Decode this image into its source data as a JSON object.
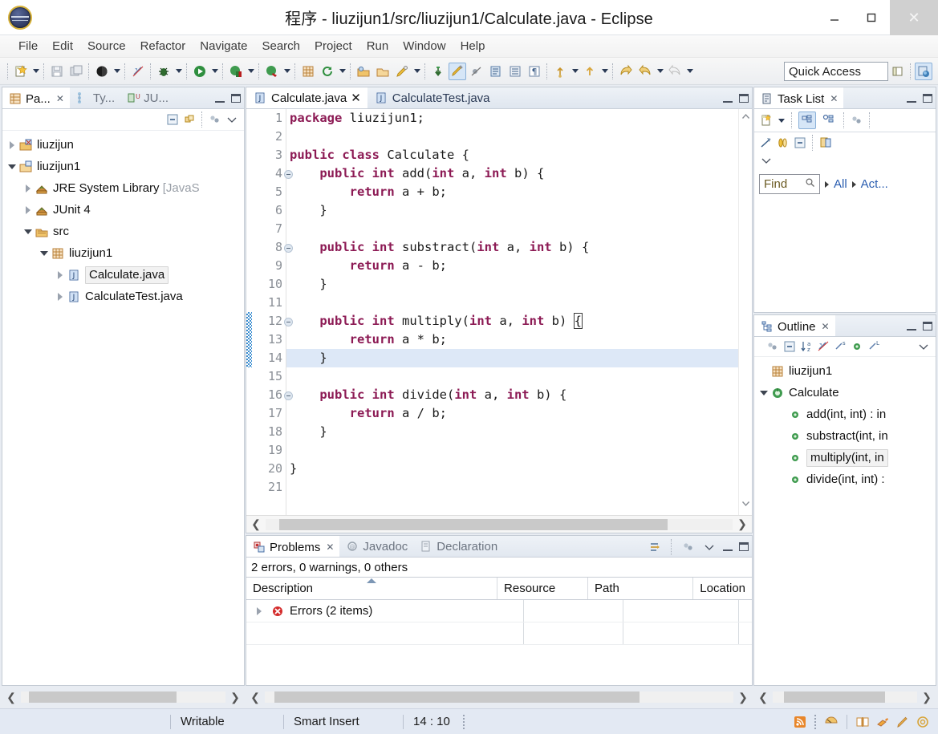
{
  "window": {
    "title": "程序 - liuzijun1/src/liuzijun1/Calculate.java - Eclipse",
    "minimize_label": "–",
    "maximize_label": "☐",
    "close_label": "✕"
  },
  "menubar": {
    "items": [
      "File",
      "Edit",
      "Source",
      "Refactor",
      "Navigate",
      "Search",
      "Project",
      "Run",
      "Window",
      "Help"
    ]
  },
  "toolbar": {
    "quick_access_placeholder": "Quick Access",
    "icons": [
      "new-wizard-icon",
      "new-wizard-dropdown",
      "save-icon",
      "save-all-icon",
      "print-icon",
      "print-dropdown",
      "toggle-breadcrumb-icon",
      "debug-icon",
      "debug-dropdown",
      "run-icon",
      "run-dropdown",
      "coverage-icon",
      "coverage-dropdown",
      "external-tools-icon",
      "external-tools-dropdown",
      "new-java-package-icon",
      "refresh-icon",
      "refresh-dropdown",
      "open-type-icon",
      "open-task-icon",
      "search-icon",
      "search-dropdown",
      "pin-editor-icon",
      "toggle-mark-occurrences-icon",
      "skip-breakpoints-icon",
      "next-annotation-icon",
      "previous-annotation-icon",
      "last-edit-location-icon",
      "last-edit-dropdown",
      "back-icon",
      "forward-icon",
      "forward-dropdown",
      "next-icon",
      "next-dropdown"
    ],
    "right_icons": [
      "new-perspective-icon",
      "java-perspective-icon"
    ]
  },
  "package_explorer": {
    "tabs": [
      {
        "label": "Pa...",
        "icon": "package-explorer-icon",
        "active": true,
        "closable": true
      },
      {
        "label": "Ty...",
        "icon": "type-hierarchy-icon",
        "active": false,
        "closable": false
      },
      {
        "label": "JU...",
        "icon": "junit-icon",
        "active": false,
        "closable": false
      }
    ],
    "toolbar_icons": [
      "collapse-all-icon",
      "link-with-editor-icon",
      "view-menu-icon",
      "view-chevron-icon"
    ],
    "controls": [
      "minimize-icon",
      "maximize-icon"
    ],
    "tree": [
      {
        "label": "liuzijun",
        "icon": "java-project-icon",
        "indent": 0,
        "twist": "closed",
        "selected": false
      },
      {
        "label": "liuzijun1",
        "icon": "java-project-open-icon",
        "indent": 0,
        "twist": "open",
        "selected": false
      },
      {
        "label": "JRE System Library",
        "suffix": " [JavaS",
        "icon": "library-icon",
        "indent": 1,
        "twist": "closed",
        "selected": false
      },
      {
        "label": "JUnit 4",
        "icon": "library-icon",
        "indent": 1,
        "twist": "closed",
        "selected": false
      },
      {
        "label": "src",
        "icon": "source-folder-icon",
        "indent": 1,
        "twist": "open",
        "selected": false
      },
      {
        "label": "liuzijun1",
        "icon": "package-icon",
        "indent": 2,
        "twist": "open",
        "selected": false
      },
      {
        "label": "Calculate.java",
        "icon": "java-file-icon",
        "indent": 3,
        "twist": "closed",
        "selected": true
      },
      {
        "label": "CalculateTest.java",
        "icon": "java-file-icon",
        "indent": 3,
        "twist": "closed",
        "selected": false
      }
    ],
    "hscroll": {
      "thumb_left_pct": 4,
      "thumb_width_pct": 72
    }
  },
  "editor": {
    "tabs": [
      {
        "label": "Calculate.java",
        "icon": "java-file-icon",
        "active": true,
        "closable": true
      },
      {
        "label": "CalculateTest.java",
        "icon": "java-file-icon",
        "active": false,
        "closable": false
      }
    ],
    "controls": [
      "minimize-icon",
      "maximize-icon"
    ],
    "lines": [
      {
        "n": 1,
        "fold": false,
        "changed": false,
        "hl": false,
        "tokens": [
          {
            "t": "package",
            "k": true
          },
          {
            "t": " liuzijun1;",
            "k": false
          }
        ]
      },
      {
        "n": 2,
        "fold": false,
        "changed": false,
        "hl": false,
        "tokens": [
          {
            "t": "",
            "k": false
          }
        ]
      },
      {
        "n": 3,
        "fold": false,
        "changed": false,
        "hl": false,
        "tokens": [
          {
            "t": "public class",
            "k": true
          },
          {
            "t": " Calculate {",
            "k": false
          }
        ]
      },
      {
        "n": 4,
        "fold": true,
        "changed": false,
        "hl": false,
        "tokens": [
          {
            "t": "    public int",
            "k": true
          },
          {
            "t": " add(",
            "k": false
          },
          {
            "t": "int",
            "k": true
          },
          {
            "t": " a, ",
            "k": false
          },
          {
            "t": "int",
            "k": true
          },
          {
            "t": " b) {",
            "k": false
          }
        ]
      },
      {
        "n": 5,
        "fold": false,
        "changed": false,
        "hl": false,
        "tokens": [
          {
            "t": "        return",
            "k": true
          },
          {
            "t": " a + b;",
            "k": false
          }
        ]
      },
      {
        "n": 6,
        "fold": false,
        "changed": false,
        "hl": false,
        "tokens": [
          {
            "t": "    }",
            "k": false
          }
        ]
      },
      {
        "n": 7,
        "fold": false,
        "changed": false,
        "hl": false,
        "tokens": [
          {
            "t": "",
            "k": false
          }
        ]
      },
      {
        "n": 8,
        "fold": true,
        "changed": false,
        "hl": false,
        "tokens": [
          {
            "t": "    public int",
            "k": true
          },
          {
            "t": " substract(",
            "k": false
          },
          {
            "t": "int",
            "k": true
          },
          {
            "t": " a, ",
            "k": false
          },
          {
            "t": "int",
            "k": true
          },
          {
            "t": " b) {",
            "k": false
          }
        ]
      },
      {
        "n": 9,
        "fold": false,
        "changed": false,
        "hl": false,
        "tokens": [
          {
            "t": "        return",
            "k": true
          },
          {
            "t": " a - b;",
            "k": false
          }
        ]
      },
      {
        "n": 10,
        "fold": false,
        "changed": false,
        "hl": false,
        "tokens": [
          {
            "t": "    }",
            "k": false
          }
        ]
      },
      {
        "n": 11,
        "fold": false,
        "changed": false,
        "hl": false,
        "tokens": [
          {
            "t": "",
            "k": false
          }
        ]
      },
      {
        "n": 12,
        "fold": true,
        "changed": true,
        "hl": false,
        "tokens": [
          {
            "t": "    public int",
            "k": true
          },
          {
            "t": " multiply(",
            "k": false
          },
          {
            "t": "int",
            "k": true
          },
          {
            "t": " a, ",
            "k": false
          },
          {
            "t": "int",
            "k": true
          },
          {
            "t": " b) ",
            "k": false
          },
          {
            "t": "{",
            "k": false,
            "bracket": true
          }
        ]
      },
      {
        "n": 13,
        "fold": false,
        "changed": true,
        "hl": false,
        "tokens": [
          {
            "t": "        return",
            "k": true
          },
          {
            "t": " a * b;",
            "k": false
          }
        ]
      },
      {
        "n": 14,
        "fold": false,
        "changed": true,
        "hl": true,
        "tokens": [
          {
            "t": "    }",
            "k": false
          }
        ]
      },
      {
        "n": 15,
        "fold": false,
        "changed": false,
        "hl": false,
        "tokens": [
          {
            "t": "",
            "k": false
          }
        ]
      },
      {
        "n": 16,
        "fold": true,
        "changed": false,
        "hl": false,
        "tokens": [
          {
            "t": "    public int",
            "k": true
          },
          {
            "t": " divide(",
            "k": false
          },
          {
            "t": "int",
            "k": true
          },
          {
            "t": " a, ",
            "k": false
          },
          {
            "t": "int",
            "k": true
          },
          {
            "t": " b) {",
            "k": false
          }
        ]
      },
      {
        "n": 17,
        "fold": false,
        "changed": false,
        "hl": false,
        "tokens": [
          {
            "t": "        return",
            "k": true
          },
          {
            "t": " a / b;",
            "k": false
          }
        ]
      },
      {
        "n": 18,
        "fold": false,
        "changed": false,
        "hl": false,
        "tokens": [
          {
            "t": "    }",
            "k": false
          }
        ]
      },
      {
        "n": 19,
        "fold": false,
        "changed": false,
        "hl": false,
        "tokens": [
          {
            "t": "",
            "k": false
          }
        ]
      },
      {
        "n": 20,
        "fold": false,
        "changed": false,
        "hl": false,
        "tokens": [
          {
            "t": "}",
            "k": false
          }
        ]
      },
      {
        "n": 21,
        "fold": false,
        "changed": false,
        "hl": false,
        "tokens": [
          {
            "t": "",
            "k": false
          }
        ]
      }
    ],
    "hscroll": {
      "thumb_left_pct": 3,
      "thumb_width_pct": 83
    }
  },
  "problems": {
    "tabs": [
      {
        "label": "Problems",
        "icon": "problems-icon",
        "active": true,
        "closable": true
      },
      {
        "label": "Javadoc",
        "icon": "javadoc-icon",
        "active": false,
        "closable": false
      },
      {
        "label": "Declaration",
        "icon": "declaration-icon",
        "active": false,
        "closable": false
      }
    ],
    "toolbar_icons": [
      "focus-on-selection-icon",
      "view-menu-icon",
      "view-chevron-icon"
    ],
    "controls": [
      "minimize-icon",
      "maximize-icon"
    ],
    "summary": "2 errors, 0 warnings, 0 others",
    "columns": [
      "Description",
      "Resource",
      "Path",
      "Location"
    ],
    "rows": [
      {
        "description": "Errors (2 items)",
        "icon": "error-icon",
        "twist": "closed",
        "resource": "",
        "path": "",
        "location": ""
      }
    ],
    "hscroll": {
      "thumb_left_pct": 2,
      "thumb_width_pct": 78
    }
  },
  "task_list": {
    "tabs": [
      {
        "label": "Task List",
        "icon": "task-list-icon",
        "active": true,
        "closable": true
      }
    ],
    "controls": [
      "minimize-icon",
      "maximize-icon"
    ],
    "toolbar_icons": [
      "new-task-icon",
      "new-task-dropdown",
      "categorized-presentation-icon",
      "scheduled-presentation-icon",
      "focus-on-workweek-icon"
    ],
    "toolbar_icons_row2": [
      "synchronize-changed-icon",
      "collapse-all-icon",
      "restore-tasks-icon",
      "view-chevron-icon"
    ],
    "find_placeholder": "Find",
    "find_icon": "search-icon",
    "filters": [
      "All",
      "Act..."
    ]
  },
  "outline": {
    "tabs": [
      {
        "label": "Outline",
        "icon": "outline-icon",
        "active": true,
        "closable": true
      }
    ],
    "controls": [
      "minimize-icon",
      "maximize-icon"
    ],
    "toolbar_icons": [
      "focus-icon",
      "collapse-all-icon",
      "sort-icon",
      "hide-fields-icon",
      "hide-static-icon",
      "hide-nonpublic-icon",
      "hide-local-icon",
      "view-chevron-icon"
    ],
    "tree": [
      {
        "label": "liuzijun1",
        "icon": "package-icon",
        "indent": 0,
        "twist": "none",
        "selected": false
      },
      {
        "label": "Calculate",
        "icon": "class-icon",
        "indent": 0,
        "twist": "open",
        "selected": false
      },
      {
        "label": "add(int, int) : in",
        "icon": "method-public-icon",
        "indent": 1,
        "twist": "none",
        "selected": false
      },
      {
        "label": "substract(int, in",
        "icon": "method-public-icon",
        "indent": 1,
        "twist": "none",
        "selected": false
      },
      {
        "label": "multiply(int, in",
        "icon": "method-public-icon",
        "indent": 1,
        "twist": "none",
        "selected": true
      },
      {
        "label": "divide(int, int) :",
        "icon": "method-public-icon",
        "indent": 1,
        "twist": "none",
        "selected": false
      }
    ],
    "hscroll": {
      "thumb_left_pct": 8,
      "thumb_width_pct": 70
    }
  },
  "statusbar": {
    "writable": "Writable",
    "insert_mode": "Smart Insert",
    "cursor_position": "14 : 10",
    "right_icons": [
      "rss-feed-icon",
      "mylyn-icon",
      "book-icon",
      "highlight-icon",
      "pencil-icon",
      "gear-icon"
    ]
  },
  "colors": {
    "keyword": "#8c1a54",
    "line_highlight": "#dde8f7",
    "change_bar": "#3d8fd1",
    "error": "#d42c2c",
    "link": "#2a5db0",
    "accent": "#d6e6f7"
  }
}
